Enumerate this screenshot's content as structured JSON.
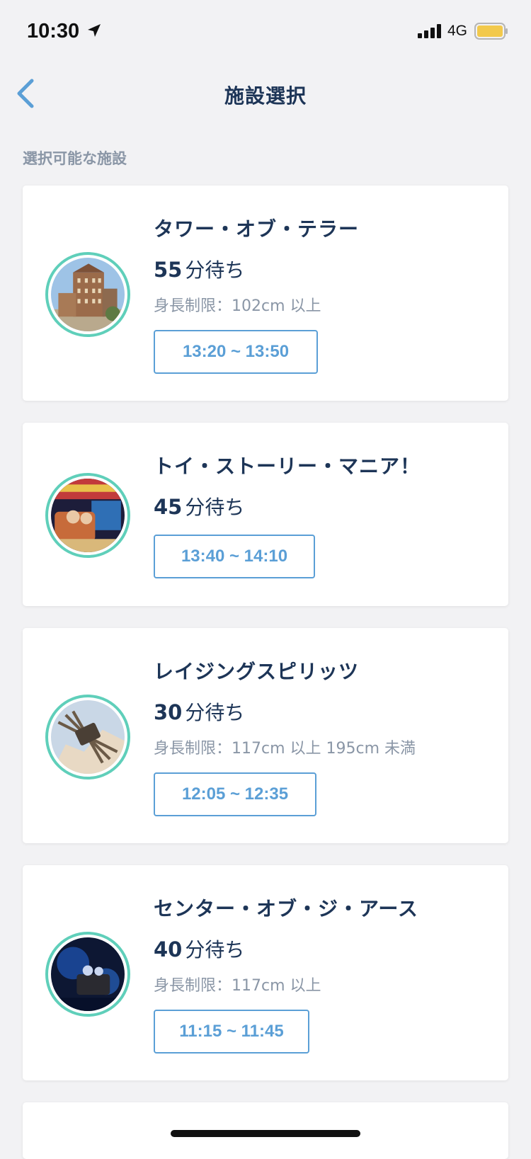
{
  "status_bar": {
    "time": "10:30",
    "network": "4G",
    "battery_color": "#f2c94c"
  },
  "nav": {
    "title": "施設選択",
    "back_icon": "chevron-left-icon",
    "accent": "#5b9fd6"
  },
  "section_label": "選択可能な施設",
  "facilities": [
    {
      "name": "タワー・オブ・テラー",
      "wait_number": "55",
      "wait_unit": "分待ち",
      "height_limit": "身長制限：102cm 以上",
      "time_slot": "13:20 ~ 13:50",
      "thumb_icon": "hotel-tower-photo"
    },
    {
      "name": "トイ・ストーリー・マニア！",
      "wait_number": "45",
      "wait_unit": "分待ち",
      "height_limit": "",
      "time_slot": "13:40 ~ 14:10",
      "thumb_icon": "ride-vehicle-photo"
    },
    {
      "name": "レイジングスピリッツ",
      "wait_number": "30",
      "wait_unit": "分待ち",
      "height_limit": "身長制限：117cm 以上 195cm 未満",
      "time_slot": "12:05 ~ 12:35",
      "thumb_icon": "coaster-photo"
    },
    {
      "name": "センター・オブ・ジ・アース",
      "wait_number": "40",
      "wait_unit": "分待ち",
      "height_limit": "身長制限：117cm 以上",
      "time_slot": "11:15 ~ 11:45",
      "thumb_icon": "cave-vehicle-photo"
    }
  ]
}
